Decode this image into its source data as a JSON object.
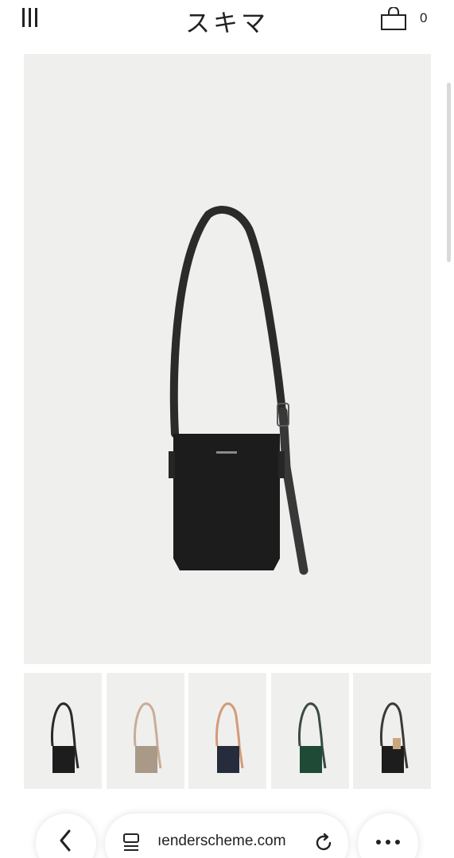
{
  "header": {
    "brand": "スキマ",
    "cart_count": "0",
    "menu_icon": "hamburger-icon",
    "cart_icon": "shopping-bag-icon"
  },
  "product": {
    "main_image": "black leather shoulder pouch with long strap",
    "thumbnails": [
      {
        "description": "black bag",
        "color": "#1d1d1d",
        "strap": "#2a2a2a"
      },
      {
        "description": "beige bag",
        "color": "#a99a88",
        "strap": "#c9ad97"
      },
      {
        "description": "navy bag with tan strap",
        "color": "#262c3c",
        "strap": "#d49a78"
      },
      {
        "description": "dark green bag",
        "color": "#1f4a36",
        "strap": "#3b4a46"
      },
      {
        "description": "black bag with card",
        "color": "#1d1d1d",
        "strap": "#3a3a3a"
      }
    ]
  },
  "browser": {
    "url": "ıenderscheme.com",
    "back_icon": "chevron-left-icon",
    "tabs_icon": "tabs-icon",
    "reload_icon": "reload-icon",
    "more_icon": "ellipsis-icon"
  },
  "colors": {
    "image_bg": "#efefee",
    "bag": "#1c1c1c"
  }
}
